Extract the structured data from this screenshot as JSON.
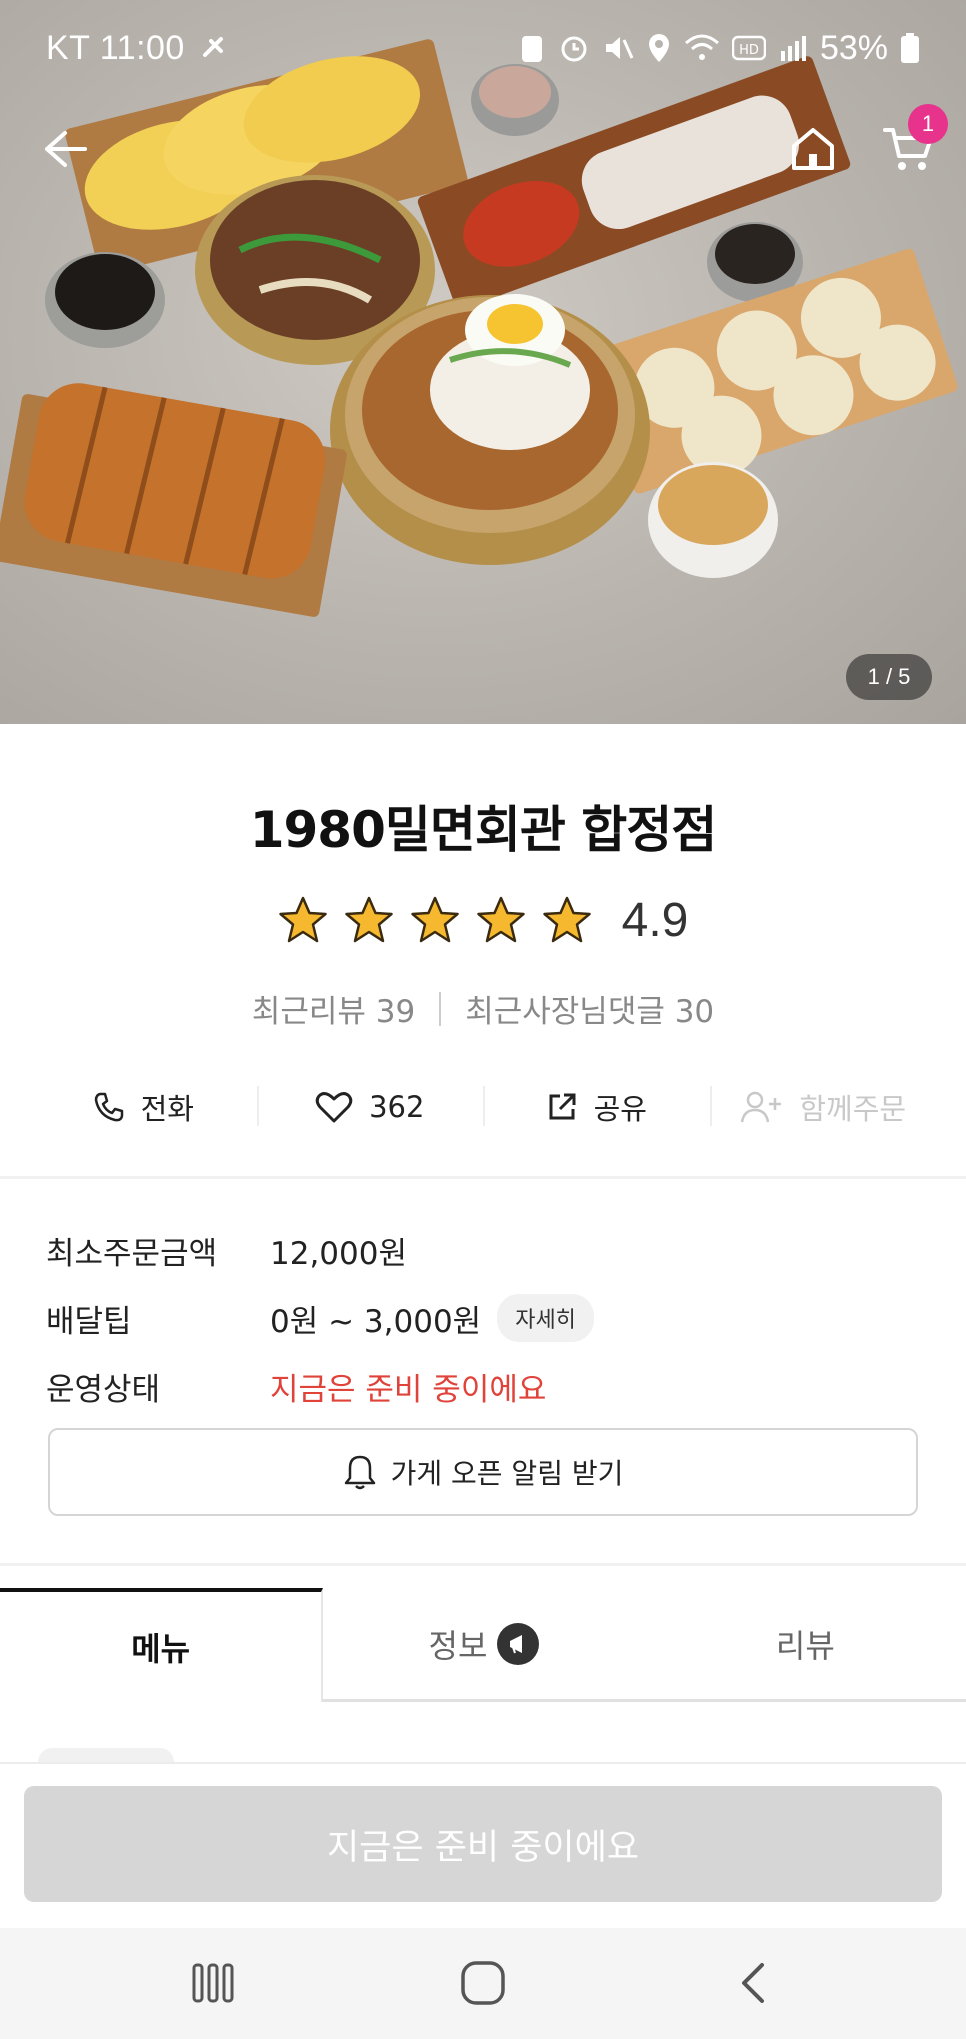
{
  "status_bar": {
    "carrier_time": "KT 11:00",
    "battery": "53%"
  },
  "top_nav": {
    "cart_count": "1"
  },
  "gallery": {
    "pager": "1 / 5"
  },
  "store": {
    "name": "1980밀면회관 합정점",
    "rating_value": 4.9,
    "rating": "4.9",
    "stars": 5,
    "recent_reviews": "최근리뷰 39",
    "owner_replies": "최근사장님댓글 30"
  },
  "actions": {
    "call": "전화",
    "likes": "362",
    "share": "공유",
    "group_order": "함께주문"
  },
  "info": {
    "min_order_label": "최소주문금액",
    "min_order_value": "12,000원",
    "delivery_tip_label": "배달팁",
    "delivery_tip_value": "0원 ~ 3,000원",
    "detail_button": "자세히",
    "status_label": "운영상태",
    "status_value": "지금은 준비 중이에요"
  },
  "notify_button": "가게 오픈 알림 받기",
  "tabs": {
    "menu": "메뉴",
    "info": "정보",
    "reviews": "리뷰"
  },
  "cta": "지금은 준비 중이에요",
  "colors": {
    "accent_red": "#e0433a",
    "badge_pink": "#e8338c",
    "star_gold": "#f5b82e"
  }
}
